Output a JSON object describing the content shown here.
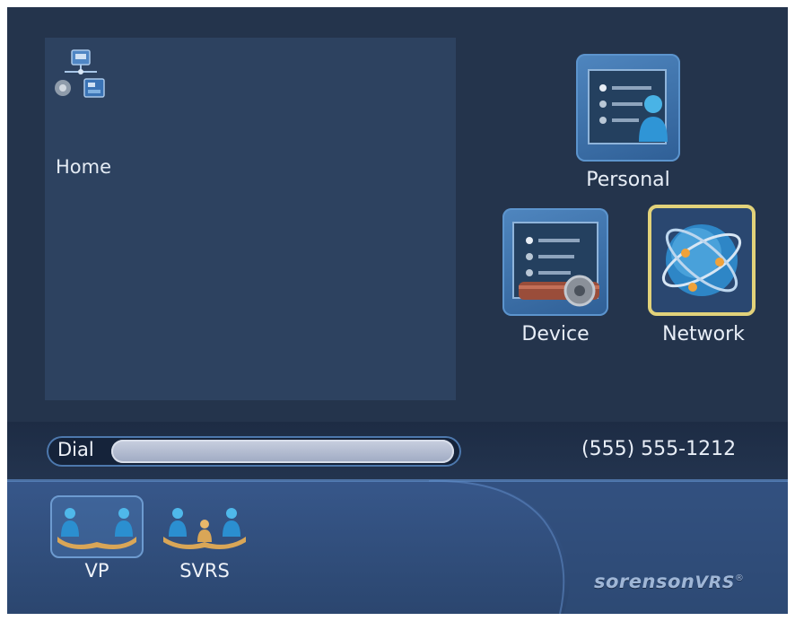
{
  "menu": {
    "home_label": "Home",
    "personal_label": "Personal",
    "device_label": "Device",
    "network_label": "Network"
  },
  "dial": {
    "label": "Dial",
    "value": "",
    "phone_number": "(555) 555-1212"
  },
  "nav": {
    "vp_label": "VP",
    "svrs_label": "SVRS"
  },
  "brand": {
    "name_part1": "sorenson",
    "name_part2": "VRS",
    "mark": "®"
  },
  "colors": {
    "background": "#24344c",
    "preview": "#2d4260",
    "tile": "#3f74ad",
    "selection": "#e2d27a",
    "dial_input": "#b4bdd1"
  },
  "icons": {
    "home": "network-devices-icon",
    "personal": "personal-settings-icon",
    "device": "device-settings-icon",
    "network": "globe-network-icon",
    "vp": "two-people-icon",
    "svrs": "three-people-icon"
  }
}
